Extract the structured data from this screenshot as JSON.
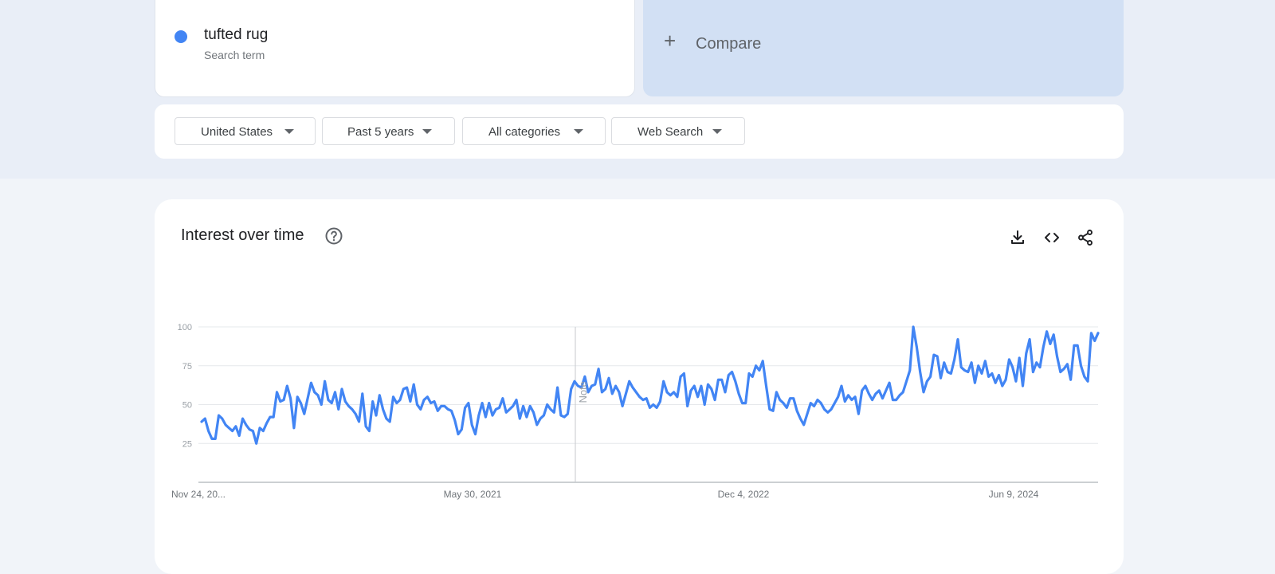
{
  "search_term": {
    "name": "tufted rug",
    "type": "Search term",
    "color": "#4285f4"
  },
  "compare": {
    "label": "Compare"
  },
  "filters": [
    {
      "label": "United States"
    },
    {
      "label": "Past 5 years"
    },
    {
      "label": "All categories"
    },
    {
      "label": "Web Search"
    }
  ],
  "chart_section": {
    "title": "Interest over time",
    "help_icon": "help-circle-icon",
    "actions": [
      "download-icon",
      "embed-code-icon",
      "share-icon"
    ],
    "note_label": "Note"
  },
  "chart_data": {
    "type": "line",
    "title": "",
    "xlabel": "",
    "ylabel": "",
    "ylim": [
      0,
      100
    ],
    "y_ticks": [
      25,
      50,
      75,
      100
    ],
    "x_tick_labels": [
      "Nov 24, 20...",
      "May 30, 2021",
      "Dec 4, 2022",
      "Jun 9, 2024"
    ],
    "grid": true,
    "color": "#4285f4",
    "series": [
      {
        "name": "tufted rug",
        "values": [
          39,
          41,
          33,
          28,
          28,
          43,
          41,
          37,
          35,
          33,
          36,
          30,
          41,
          37,
          34,
          33,
          25,
          35,
          33,
          38,
          42,
          42,
          58,
          52,
          53,
          62,
          54,
          35,
          55,
          51,
          44,
          54,
          64,
          58,
          56,
          50,
          65,
          53,
          51,
          58,
          47,
          60,
          52,
          49,
          47,
          44,
          39,
          57,
          36,
          33,
          52,
          43,
          56,
          47,
          41,
          39,
          55,
          51,
          53,
          60,
          61,
          52,
          63,
          50,
          47,
          53,
          55,
          51,
          52,
          46,
          49,
          49,
          47,
          46,
          40,
          31,
          34,
          48,
          51,
          37,
          31,
          43,
          51,
          42,
          51,
          43,
          47,
          48,
          54,
          45,
          47,
          49,
          53,
          41,
          49,
          42,
          49,
          45,
          37,
          41,
          43,
          50,
          47,
          45,
          61,
          43,
          42,
          44,
          60,
          65,
          62,
          61,
          68,
          58,
          62,
          63,
          73,
          58,
          60,
          67,
          57,
          62,
          58,
          49,
          57,
          65,
          61,
          58,
          55,
          53,
          54,
          48,
          50,
          48,
          52,
          65,
          58,
          56,
          58,
          55,
          68,
          70,
          49,
          59,
          62,
          55,
          62,
          50,
          63,
          60,
          53,
          66,
          66,
          58,
          69,
          71,
          65,
          57,
          51,
          51,
          70,
          68,
          75,
          72,
          78,
          62,
          47,
          46,
          58,
          53,
          51,
          48,
          54,
          54,
          46,
          41,
          37,
          44,
          51,
          49,
          53,
          51,
          47,
          45,
          47,
          51,
          55,
          62,
          52,
          56,
          53,
          55,
          44,
          59,
          62,
          57,
          53,
          57,
          59,
          54,
          59,
          64,
          53,
          53,
          56,
          58,
          65,
          72,
          100,
          87,
          71,
          58,
          65,
          68,
          82,
          81,
          67,
          77,
          71,
          70,
          79,
          92,
          74,
          72,
          71,
          77,
          64,
          75,
          70,
          78,
          68,
          70,
          64,
          69,
          62,
          66,
          79,
          74,
          65,
          80,
          62,
          83,
          92,
          71,
          77,
          74,
          87,
          97,
          89,
          95,
          81,
          71,
          73,
          76,
          66,
          88,
          88,
          75,
          68,
          65,
          96,
          91,
          96
        ]
      }
    ]
  }
}
